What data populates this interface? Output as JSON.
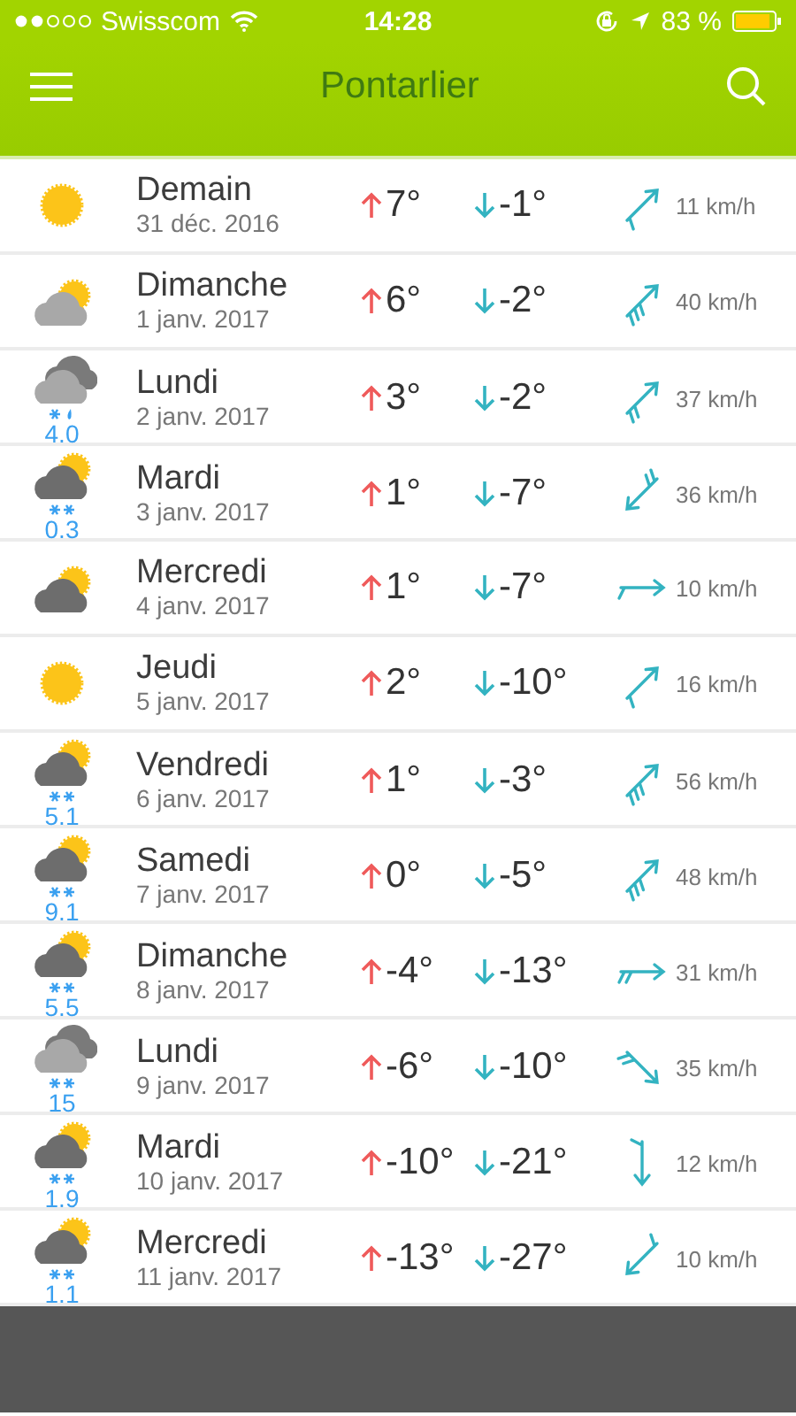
{
  "status_bar": {
    "carrier": "Swisscom",
    "time": "14:28",
    "battery": "83 %"
  },
  "header": {
    "title": "Pontarlier"
  },
  "days": [
    {
      "day": "Demain",
      "date": "31 déc. 2016",
      "sky": {
        "kind": "sun"
      },
      "high": "7°",
      "low": "-1°",
      "wind": {
        "kind": "northeast-light",
        "speed": "11 km/h"
      }
    },
    {
      "day": "Dimanche",
      "date": "1 janv. 2017",
      "sky": {
        "kind": "lightcloud"
      },
      "high": "6°",
      "low": "-2°",
      "wind": {
        "kind": "northeast-strong",
        "speed": "40 km/h"
      }
    },
    {
      "day": "Lundi",
      "date": "2 janv. 2017",
      "sky": {
        "kind": "overcast"
      },
      "precip": {
        "kind": "sleet",
        "amount": "4.0"
      },
      "high": "3°",
      "low": "-2°",
      "wind": {
        "kind": "northeast-moderate",
        "speed": "37 km/h"
      }
    },
    {
      "day": "Mardi",
      "date": "3 janv. 2017",
      "sky": {
        "kind": "cloudsun"
      },
      "precip": {
        "kind": "snow",
        "amount": "0.3"
      },
      "high": "1°",
      "low": "-7°",
      "wind": {
        "kind": "southwest-moderate",
        "speed": "36 km/h"
      }
    },
    {
      "day": "Mercredi",
      "date": "4 janv. 2017",
      "sky": {
        "kind": "cloudsun"
      },
      "high": "1°",
      "low": "-7°",
      "wind": {
        "kind": "east-light",
        "speed": "10 km/h"
      }
    },
    {
      "day": "Jeudi",
      "date": "5 janv. 2017",
      "sky": {
        "kind": "sun"
      },
      "high": "2°",
      "low": "-10°",
      "wind": {
        "kind": "northeast-light",
        "speed": "16 km/h"
      }
    },
    {
      "day": "Vendredi",
      "date": "6 janv. 2017",
      "sky": {
        "kind": "cloudsun"
      },
      "precip": {
        "kind": "snow",
        "amount": "5.1"
      },
      "high": "1°",
      "low": "-3°",
      "wind": {
        "kind": "northeast-strong",
        "speed": "56 km/h"
      }
    },
    {
      "day": "Samedi",
      "date": "7 janv. 2017",
      "sky": {
        "kind": "cloudsun"
      },
      "precip": {
        "kind": "snow",
        "amount": "9.1"
      },
      "high": "0°",
      "low": "-5°",
      "wind": {
        "kind": "northeast-strong",
        "speed": "48 km/h"
      }
    },
    {
      "day": "Dimanche",
      "date": "8 janv. 2017",
      "sky": {
        "kind": "cloudsun"
      },
      "precip": {
        "kind": "snow",
        "amount": "5.5"
      },
      "high": "-4°",
      "low": "-13°",
      "wind": {
        "kind": "east-moderate",
        "speed": "31 km/h"
      }
    },
    {
      "day": "Lundi",
      "date": "9 janv. 2017",
      "sky": {
        "kind": "overcast"
      },
      "precip": {
        "kind": "snow",
        "amount": "15"
      },
      "high": "-6°",
      "low": "-10°",
      "wind": {
        "kind": "southeast-moderate",
        "speed": "35 km/h"
      }
    },
    {
      "day": "Mardi",
      "date": "10 janv. 2017",
      "sky": {
        "kind": "cloudsun"
      },
      "precip": {
        "kind": "snow",
        "amount": "1.9"
      },
      "high": "-10°",
      "low": "-21°",
      "wind": {
        "kind": "south-light",
        "speed": "12 km/h"
      }
    },
    {
      "day": "Mercredi",
      "date": "11 janv. 2017",
      "sky": {
        "kind": "cloudsun"
      },
      "precip": {
        "kind": "snow",
        "amount": "1.1"
      },
      "high": "-13°",
      "low": "-27°",
      "wind": {
        "kind": "southwest-light",
        "speed": "10 km/h"
      }
    }
  ]
}
